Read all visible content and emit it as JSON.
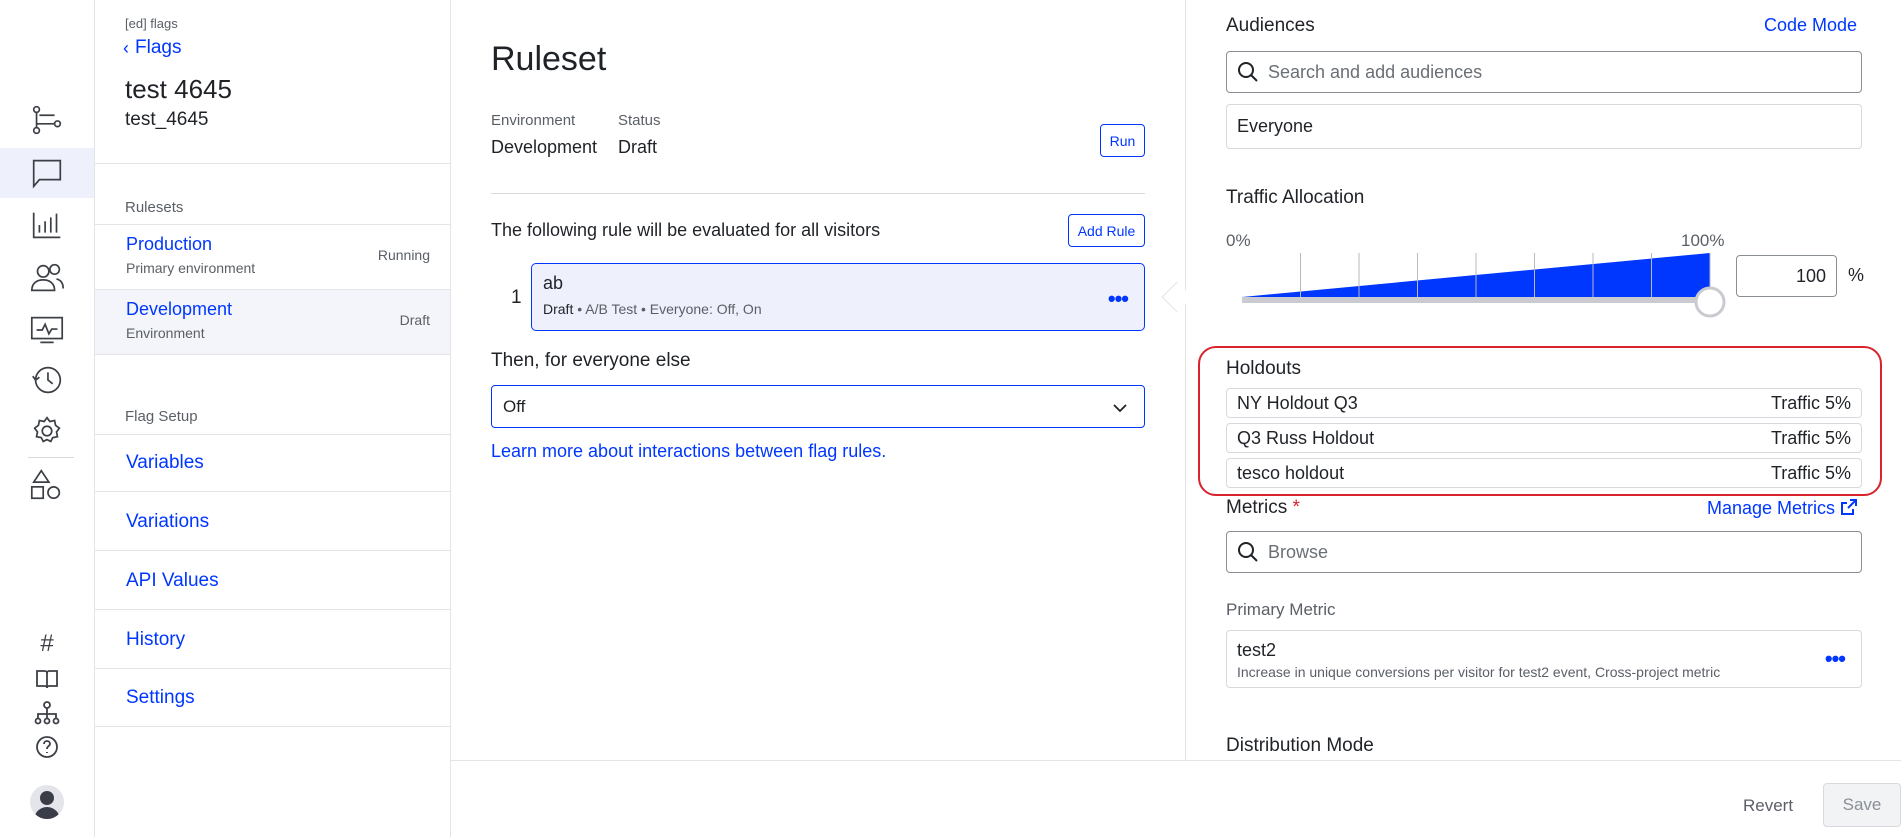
{
  "rail": {
    "icons": [
      "flow-icon",
      "flag-icon",
      "chart-icon",
      "users-icon",
      "monitor-icon",
      "history-icon",
      "settings-icon",
      "shapes-icon",
      "hash-icon",
      "book-icon",
      "hierarchy-icon",
      "help-icon"
    ],
    "hash_glyph": "#"
  },
  "sidebar": {
    "project": "[ed] flags",
    "back_label": "Flags",
    "flag_name": "test 4645",
    "flag_key": "test_4645",
    "rulesets_label": "Rulesets",
    "rulesets": [
      {
        "name": "Production",
        "desc": "Primary environment",
        "status": "Running"
      },
      {
        "name": "Development",
        "desc": "Environment",
        "status": "Draft"
      }
    ],
    "flag_setup_label": "Flag Setup",
    "setup_items": [
      "Variables",
      "Variations",
      "API Values",
      "History",
      "Settings"
    ]
  },
  "main": {
    "title": "Ruleset",
    "env_label": "Environment",
    "env_value": "Development",
    "status_label": "Status",
    "status_value": "Draft",
    "run_label": "Run",
    "rule_intro": "The following rule will be evaluated for all visitors",
    "add_rule_label": "Add Rule",
    "rule": {
      "index": "1",
      "name": "ab",
      "status": "Draft",
      "meta": " • A/B Test • Everyone: Off, On"
    },
    "else_label": "Then, for everyone else",
    "else_value": "Off",
    "learn_link": "Learn more about interactions between flag rules."
  },
  "panel": {
    "audiences_label": "Audiences",
    "code_mode": "Code Mode",
    "audience_search_placeholder": "Search and add audiences",
    "audience_selected": "Everyone",
    "traffic_label": "Traffic Allocation",
    "pct_min": "0%",
    "pct_max": "100%",
    "traffic_value": "100",
    "traffic_fraction": 1.0,
    "pct_sign": "%",
    "holdouts_label": "Holdouts",
    "holdouts": [
      {
        "name": "NY Holdout Q3",
        "traffic": "Traffic 5%"
      },
      {
        "name": "Q3 Russ Holdout",
        "traffic": "Traffic 5%"
      },
      {
        "name": "tesco holdout",
        "traffic": "Traffic 5%"
      }
    ],
    "metrics_label": "Metrics",
    "required_mark": "*",
    "manage_metrics": "Manage Metrics",
    "metrics_search_placeholder": "Browse",
    "primary_metric_label": "Primary Metric",
    "primary_metric": {
      "name": "test2",
      "desc": "Increase in unique conversions per visitor for test2 event, Cross-project metric"
    },
    "distribution_label": "Distribution Mode"
  },
  "footer": {
    "revert_label": "Revert",
    "save_label": "Save"
  },
  "colors": {
    "accent": "#0037ff",
    "highlight": "#d9232d"
  }
}
